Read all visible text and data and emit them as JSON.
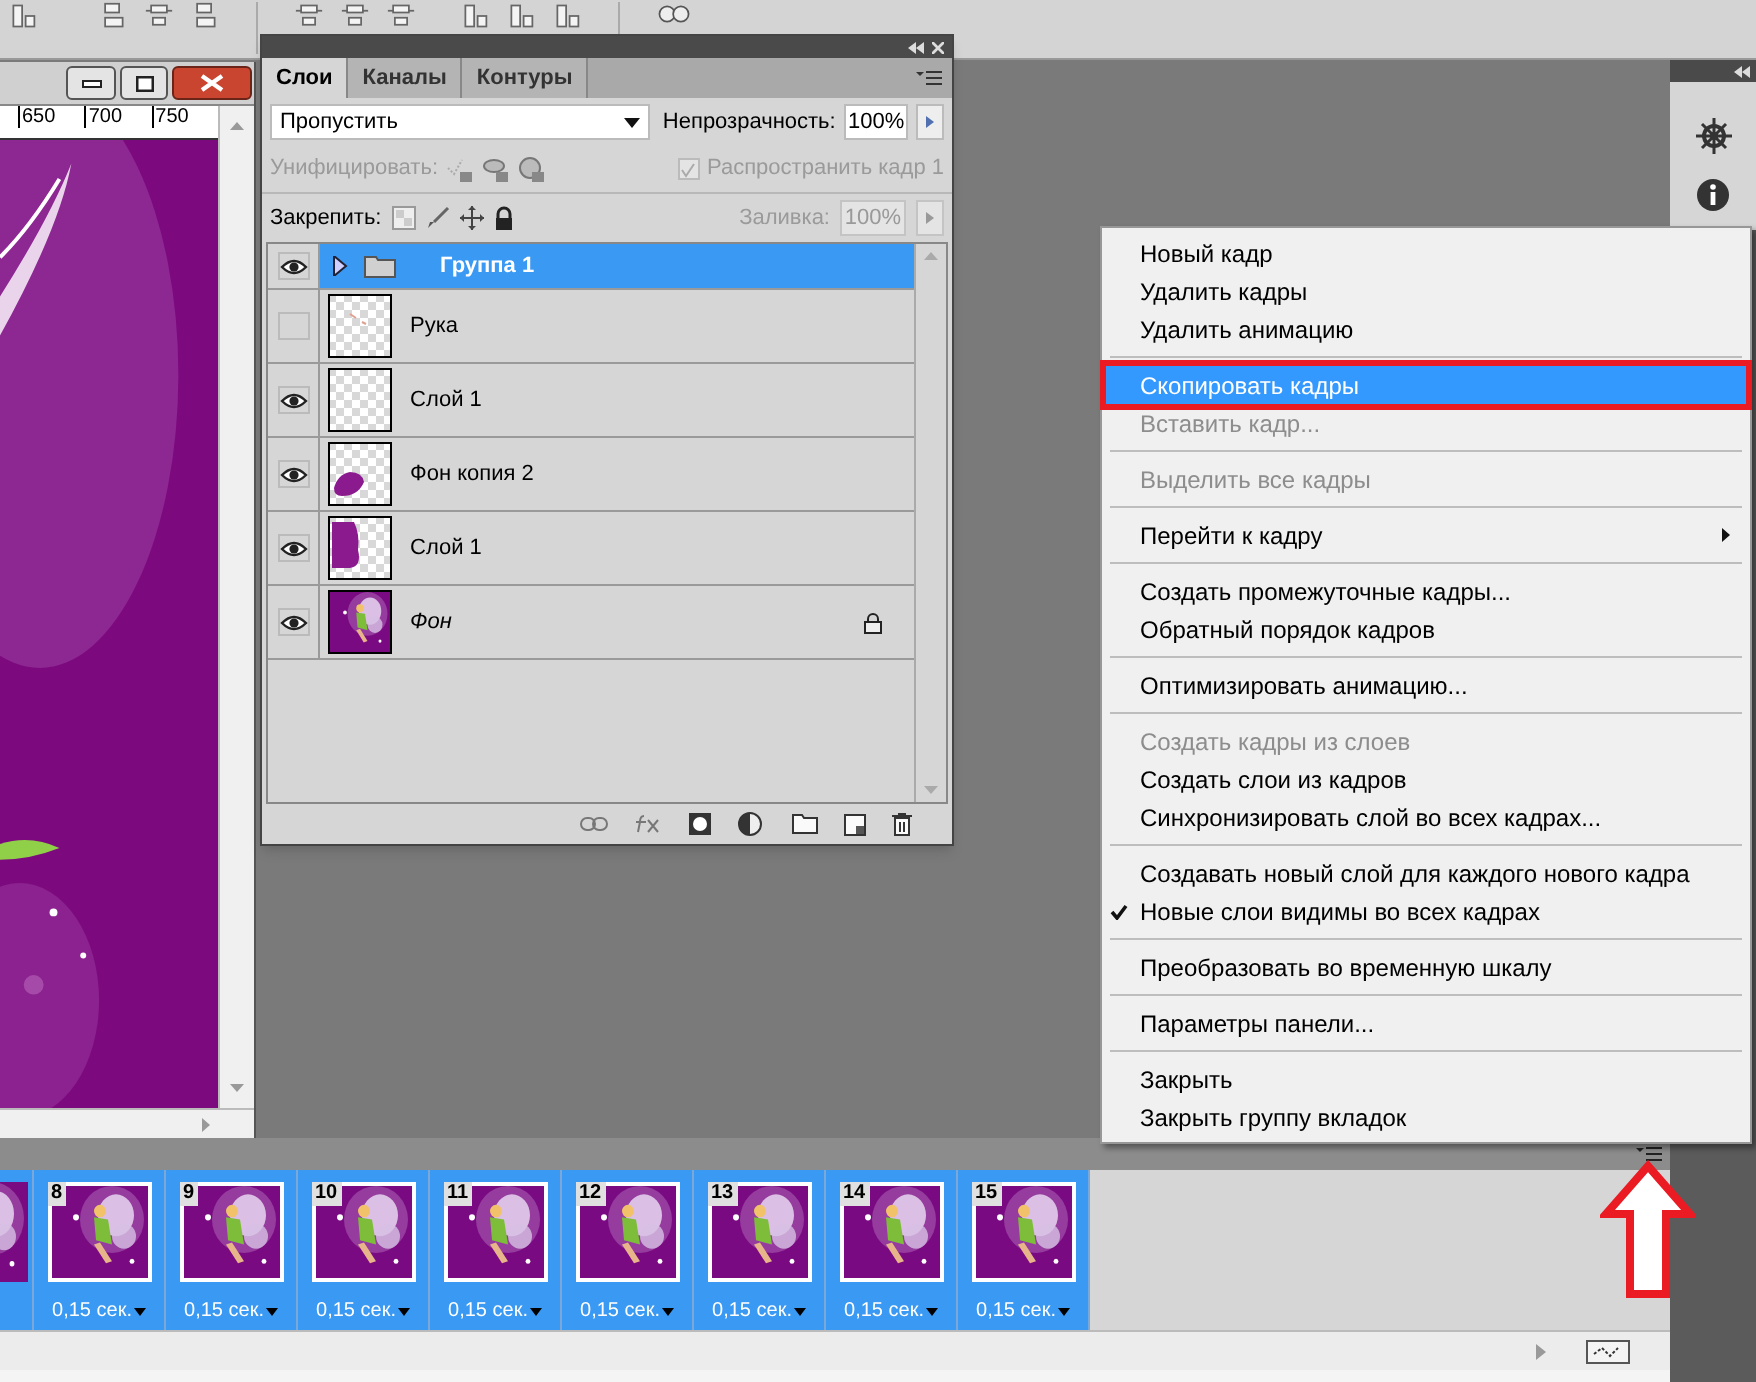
{
  "document": {
    "ruler_labels": [
      "650",
      "700",
      "750"
    ]
  },
  "layers_panel": {
    "tabs": [
      {
        "label": "Слои",
        "selected": true
      },
      {
        "label": "Каналы",
        "selected": false
      },
      {
        "label": "Контуры",
        "selected": false
      }
    ],
    "blend_mode": "Пропустить",
    "opacity_label": "Непрозрачность:",
    "opacity": "100%",
    "unify_label": "Унифицировать:",
    "propagate": {
      "label": "Распространить кадр 1",
      "checked": true,
      "disabled": true
    },
    "lock_label": "Закрепить:",
    "fill_label": "Заливка:",
    "fill": "100%",
    "layers": [
      {
        "name": "Группа 1",
        "kind": "group",
        "visible": true,
        "selected": true,
        "expanded": false,
        "locked": false
      },
      {
        "name": "Рука",
        "kind": "layer",
        "visible": false,
        "selected": false,
        "thumbnail": {
          "kind": "specks"
        },
        "locked": false
      },
      {
        "name": "Слой 1",
        "kind": "layer",
        "visible": true,
        "selected": false,
        "thumbnail": {
          "kind": "empty"
        },
        "locked": false
      },
      {
        "name": "Фон копия 2",
        "kind": "layer",
        "visible": true,
        "selected": false,
        "thumbnail": {
          "kind": "blob_low"
        },
        "locked": false
      },
      {
        "name": "Слой 1",
        "kind": "layer",
        "visible": true,
        "selected": false,
        "thumbnail": {
          "kind": "blob_left"
        },
        "locked": false
      },
      {
        "name": "Фон",
        "kind": "background",
        "visible": true,
        "selected": false,
        "locked": true
      }
    ]
  },
  "context_menu": [
    {
      "kind": "item",
      "label": "Новый кадр",
      "disabled": false,
      "selected": false,
      "checked": false,
      "submenu": false,
      "outlined": false
    },
    {
      "kind": "item",
      "label": "Удалить кадры",
      "disabled": false,
      "selected": false,
      "checked": false,
      "submenu": false,
      "outlined": false
    },
    {
      "kind": "item",
      "label": "Удалить анимацию",
      "disabled": false,
      "selected": false,
      "checked": false,
      "submenu": false,
      "outlined": false
    },
    {
      "kind": "separator"
    },
    {
      "kind": "item",
      "label": "Скопировать кадры",
      "disabled": false,
      "selected": true,
      "checked": false,
      "submenu": false,
      "outlined": true
    },
    {
      "kind": "item",
      "label": "Вставить кадр...",
      "disabled": true,
      "selected": false,
      "checked": false,
      "submenu": false,
      "outlined": false
    },
    {
      "kind": "separator"
    },
    {
      "kind": "item",
      "label": "Выделить все кадры",
      "disabled": true,
      "selected": false,
      "checked": false,
      "submenu": false,
      "outlined": false
    },
    {
      "kind": "separator"
    },
    {
      "kind": "item",
      "label": "Перейти к кадру",
      "disabled": false,
      "selected": false,
      "checked": false,
      "submenu": true,
      "outlined": false
    },
    {
      "kind": "separator"
    },
    {
      "kind": "item",
      "label": "Создать промежуточные кадры...",
      "disabled": false,
      "selected": false,
      "checked": false,
      "submenu": false,
      "outlined": false
    },
    {
      "kind": "item",
      "label": "Обратный порядок кадров",
      "disabled": false,
      "selected": false,
      "checked": false,
      "submenu": false,
      "outlined": false
    },
    {
      "kind": "separator"
    },
    {
      "kind": "item",
      "label": "Оптимизировать анимацию...",
      "disabled": false,
      "selected": false,
      "checked": false,
      "submenu": false,
      "outlined": false
    },
    {
      "kind": "separator"
    },
    {
      "kind": "item",
      "label": "Создать кадры из слоев",
      "disabled": true,
      "selected": false,
      "checked": false,
      "submenu": false,
      "outlined": false
    },
    {
      "kind": "item",
      "label": "Создать слои из кадров",
      "disabled": false,
      "selected": false,
      "checked": false,
      "submenu": false,
      "outlined": false
    },
    {
      "kind": "item",
      "label": "Синхронизировать слой во всех кадрах...",
      "disabled": false,
      "selected": false,
      "checked": false,
      "submenu": false,
      "outlined": false
    },
    {
      "kind": "separator"
    },
    {
      "kind": "item",
      "label": "Создавать новый слой для каждого нового кадра",
      "disabled": false,
      "selected": false,
      "checked": false,
      "submenu": false,
      "outlined": false
    },
    {
      "kind": "item",
      "label": "Новые слои видимы во всех кадрах",
      "disabled": false,
      "selected": false,
      "checked": true,
      "submenu": false,
      "outlined": false
    },
    {
      "kind": "separator"
    },
    {
      "kind": "item",
      "label": "Преобразовать во временную шкалу",
      "disabled": false,
      "selected": false,
      "checked": false,
      "submenu": false,
      "outlined": false
    },
    {
      "kind": "separator"
    },
    {
      "kind": "item",
      "label": "Параметры панели...",
      "disabled": false,
      "selected": false,
      "checked": false,
      "submenu": false,
      "outlined": false
    },
    {
      "kind": "separator"
    },
    {
      "kind": "item",
      "label": "Закрыть",
      "disabled": false,
      "selected": false,
      "checked": false,
      "submenu": false,
      "outlined": false
    },
    {
      "kind": "item",
      "label": "Закрыть группу вкладок",
      "disabled": false,
      "selected": false,
      "checked": false,
      "submenu": false,
      "outlined": false
    }
  ],
  "frames": [
    {
      "number": "8",
      "delay": "0,15 сек.",
      "selected": true
    },
    {
      "number": "9",
      "delay": "0,15 сек.",
      "selected": true
    },
    {
      "number": "10",
      "delay": "0,15 сек.",
      "selected": true
    },
    {
      "number": "11",
      "delay": "0,15 сек.",
      "selected": true
    },
    {
      "number": "12",
      "delay": "0,15 сек.",
      "selected": true
    },
    {
      "number": "13",
      "delay": "0,15 сек.",
      "selected": true
    },
    {
      "number": "14",
      "delay": "0,15 сек.",
      "selected": true
    },
    {
      "number": "15",
      "delay": "0,15 сек.",
      "selected": true
    }
  ]
}
